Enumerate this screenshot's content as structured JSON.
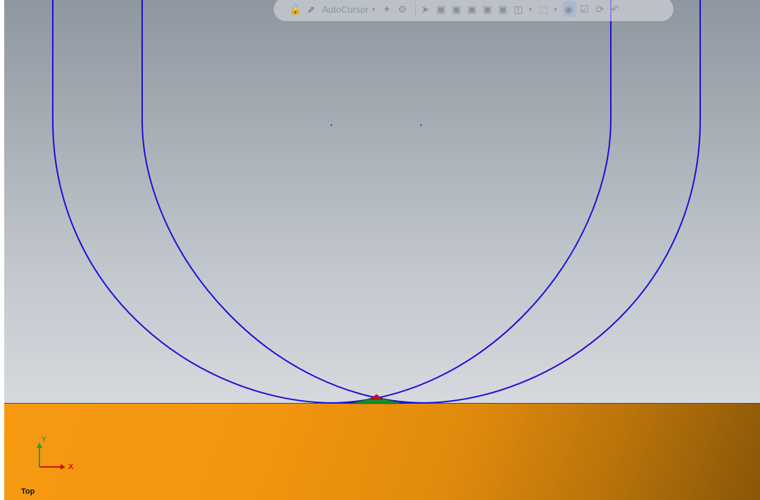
{
  "toolbar": {
    "cursor_mode_label": "AutoCursor",
    "icons": [
      "lock-icon",
      "select-cursor-icon",
      "magic-wand-icon",
      "gear-icon",
      "pointer-icon",
      "view-cube-1-icon",
      "view-cube-2-icon",
      "view-cube-3-icon",
      "view-cube-4-icon",
      "view-cube-5-icon",
      "select-box-icon",
      "marquee-select-icon",
      "display-toggle-icon",
      "checkbox-select-icon",
      "rotate-icon",
      "undo-arrow-icon"
    ]
  },
  "viewport": {
    "view_name": "Top",
    "axis_x_label": "X",
    "axis_y_label": "Y"
  },
  "colors": {
    "curve": "#1a10d8",
    "ground_top": "#f79a12",
    "ground_dark": "#8a5608",
    "marker_red": "#d01020",
    "marker_green": "#1a8a2a"
  }
}
